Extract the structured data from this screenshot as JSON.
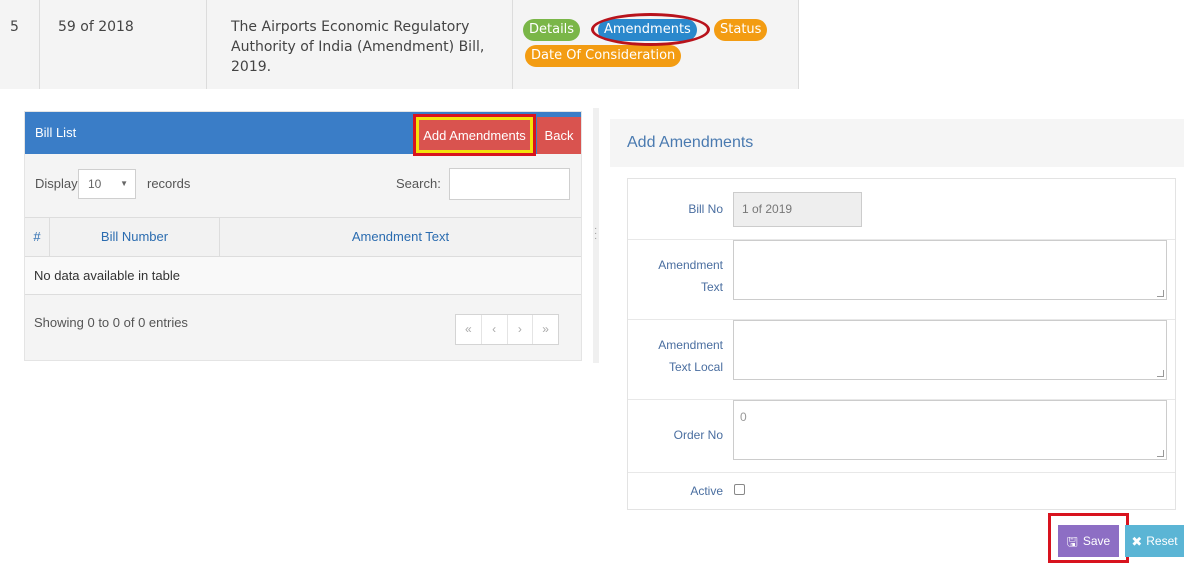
{
  "bill_row": {
    "serial": "5",
    "number": "59 of 2018",
    "title": "The Airports Economic Regulatory Authority of India (Amendment) Bill, 2019.",
    "tags": {
      "details": "Details",
      "amendments": "Amendments",
      "status": "Status",
      "date_of_consideration": "Date Of Consideration"
    }
  },
  "bill_list": {
    "title": "Bill List",
    "add_button": "Add Amendments",
    "back_button": "Back",
    "display_label": "Display",
    "page_length": "10",
    "records_label": "records",
    "search_label": "Search:",
    "search_value": "",
    "columns": [
      "#",
      "Bill Number",
      "Amendment Text"
    ],
    "empty_message": "No data available in table",
    "info": "Showing 0 to 0 of 0 entries",
    "pager": [
      "«",
      "‹",
      "›",
      "»"
    ]
  },
  "form": {
    "title": "Add Amendments",
    "bill_no_label": "Bill No",
    "bill_no_value": "1 of 2019",
    "amendment_text_label": [
      "Amendment",
      "Text"
    ],
    "amendment_text_value": "",
    "amendment_text_local_label": [
      "Amendment",
      "Text Local"
    ],
    "amendment_text_local_value": "",
    "order_no_label": "Order No",
    "order_no_value": "0",
    "active_label": "Active",
    "active_checked": false,
    "save_button": "Save",
    "reset_button": "Reset"
  },
  "icons": {
    "save": "floppy-disk-icon",
    "reset": "times-icon",
    "select_arrow": "triangle-down-icon"
  },
  "colors": {
    "panel_header": "#3a7dc7",
    "danger": "#d9534f",
    "details_tag": "#7ab648",
    "amendments_tag": "#2a88cc",
    "status_tag": "#f39c12",
    "save_button": "#8d6ec4",
    "reset_button": "#5bb5d5",
    "highlight_red": "#d8131e",
    "highlight_yellow": "#f5e10b"
  }
}
